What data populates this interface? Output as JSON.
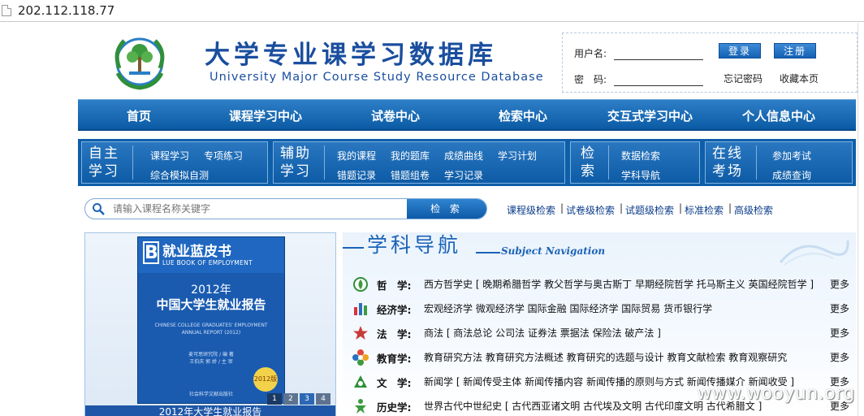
{
  "address_bar": {
    "url": "202.112.118.77"
  },
  "header": {
    "title_cn": "大学专业课学习数据库",
    "title_en": "University Major Course Study Resource Database"
  },
  "login": {
    "username_label": "用户名:",
    "password_label": "密　码:",
    "login_button": "登录",
    "register_button": "注册",
    "forgot_password": "忘记密码",
    "bookmark": "收藏本页"
  },
  "main_nav": [
    "首页",
    "课程学习中心",
    "试卷中心",
    "检索中心",
    "交互式学习中心",
    "个人信息中心"
  ],
  "sub_nav": {
    "self_study": {
      "title": "自主学习",
      "links": [
        "课程学习",
        "专项练习",
        "综合模拟自测"
      ]
    },
    "assist": {
      "title": "辅助学习",
      "links": [
        "我的课程",
        "我的题库",
        "成绩曲线",
        "学习计划",
        "错题记录",
        "错题组卷",
        "学习记录"
      ]
    },
    "search": {
      "title": "检索",
      "links": [
        "数据检索",
        "学科导航"
      ]
    },
    "online_exam": {
      "title": "在线考场",
      "links": [
        "参加考试",
        "成绩查询"
      ]
    }
  },
  "search": {
    "placeholder": "请输入课程名称关键字",
    "button": "检 索",
    "quick_links": [
      "课程级检索",
      "试卷级检索",
      "试题级检索",
      "标准检索",
      "高级检索"
    ]
  },
  "feature": {
    "book_letter": "B",
    "book_series": "就业蓝皮书",
    "book_series_en": "LUE BOOK OF EMPLOYMENT",
    "book_year": "2012年",
    "book_title": "中国大学生就业报告",
    "book_en_1": "CHINESE COLLEGE GRADUATES' EMPLOYMENT",
    "book_en_2": "ANNUAL REPORT (2012)",
    "book_author_1": "麦可思研究院 / 编 著",
    "book_author_2": "王伯庆  郭 娇 / 主 审",
    "book_badge": "2012版",
    "book_publisher": "社会科学文献出版社",
    "pages": [
      "1",
      "2",
      "3",
      "4"
    ],
    "caption": "2012年大学生就业报告"
  },
  "subject_nav": {
    "title_cn": "学科导航",
    "title_en": "Subject Navigation",
    "more_label": "更多",
    "rows": [
      {
        "category": "哲　学:",
        "items": "西方哲学史 [ 晚期希腊哲学 教父哲学与奥古斯丁 早期经院哲学 托马斯主义 英国经院哲学 ]",
        "icon": "leaf-icon"
      },
      {
        "category": "经济学:",
        "items": "宏观经济学 微观经济学 国际金融 国际经济学 国际贸易 货币银行学",
        "icon": "bar-chart-icon"
      },
      {
        "category": "法　学:",
        "items": "商法 [ 商法总论 公司法 证券法 票据法 保险法 破产法 ]",
        "icon": "star-icon"
      },
      {
        "category": "教育学:",
        "items": "教育研究方法 教育研究方法概述 教育研究的选题与设计 教育文献检索 教育观察研究",
        "icon": "flower-icon"
      },
      {
        "category": "文　学:",
        "items": "新闻学 [ 新闻传受主体 新闻传播内容 新闻传播的原则与方式 新闻传播媒介 新闻收受 ]",
        "icon": "triangle-icon"
      },
      {
        "category": "历史学:",
        "items": "世界古代中世纪史 [ 古代西亚诸文明 古代埃及文明 古代印度文明 古代希腊文 ]",
        "icon": "figure-icon"
      }
    ]
  },
  "watermark": "www.wooyun.org"
}
